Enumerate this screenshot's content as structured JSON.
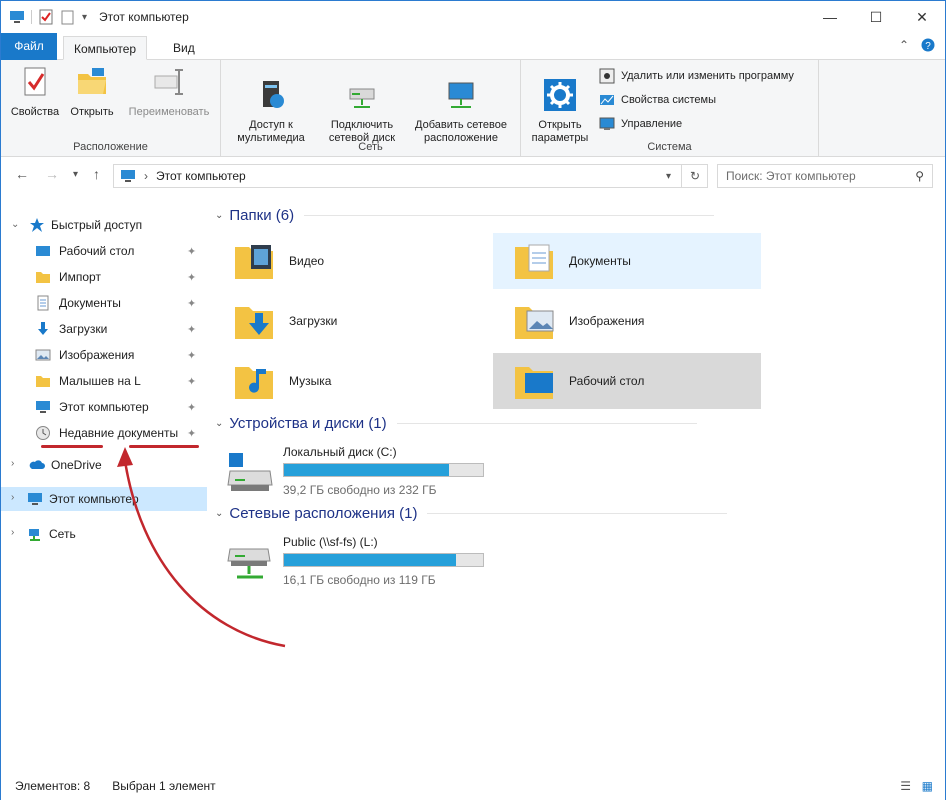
{
  "window": {
    "title": "Этот компьютер",
    "minimize_glyph": "—",
    "maximize_glyph": "☐",
    "close_glyph": "✕"
  },
  "tabs": {
    "file": "Файл",
    "computer": "Компьютер",
    "view": "Вид"
  },
  "ribbon": {
    "location": {
      "label": "Расположение",
      "properties": "Свойства",
      "open": "Открыть",
      "rename": "Переименовать"
    },
    "network": {
      "label": "Сеть",
      "media_access": "Доступ к\nмультимедиа",
      "map_drive": "Подключить\nсетевой диск",
      "add_location": "Добавить сетевое\nрасположение"
    },
    "system": {
      "label": "Система",
      "open_settings": "Открыть\nпараметры",
      "uninstall": "Удалить или изменить программу",
      "sys_props": "Свойства системы",
      "manage": "Управление"
    }
  },
  "address": {
    "path": "Этот компьютер",
    "search_placeholder": "Поиск: Этот компьютер"
  },
  "nav": {
    "quick_access": "Быстрый доступ",
    "pinned": [
      "Рабочий стол",
      "Импорт",
      "Документы",
      "Загрузки",
      "Изображения",
      "Малышев на L",
      "Этот компьютер",
      "Недавние документы"
    ],
    "onedrive": "OneDrive",
    "this_pc": "Этот компьютер",
    "network": "Сеть"
  },
  "sections": {
    "folders": "Папки (6)",
    "devices": "Устройства и диски (1)",
    "network_locations": "Сетевые расположения (1)"
  },
  "folders": [
    "Видео",
    "Документы",
    "Загрузки",
    "Изображения",
    "Музыка",
    "Рабочий стол"
  ],
  "drives": [
    {
      "name": "Локальный диск (C:)",
      "free": "39,2 ГБ свободно из 232 ГБ",
      "used_fraction": 0.83
    },
    {
      "name": "Public (\\\\sf-fs) (L:)",
      "free": "16,1 ГБ свободно из 119 ГБ",
      "used_fraction": 0.865
    }
  ],
  "status": {
    "items": "Элементов: 8",
    "selected": "Выбран 1 элемент"
  },
  "colors": {
    "accent": "#1979ca",
    "selection": "#cce8ff",
    "annotation": "#c2272d",
    "bar": "#26a0da"
  }
}
